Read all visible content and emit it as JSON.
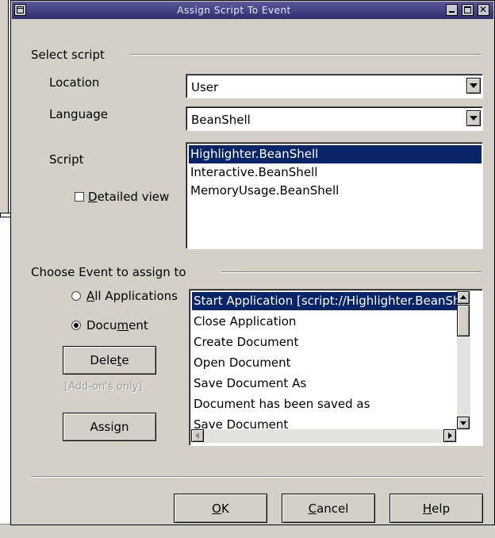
{
  "window": {
    "title": "Assign Script To Event"
  },
  "select_script": {
    "section_label": "Select script",
    "location_label": "Location",
    "location_value": "User",
    "language_label": "Language",
    "language_value": "BeanShell",
    "script_label": "Script",
    "detailed_view_label": "Detailed view",
    "scripts": [
      "Highlighter.BeanShell",
      "Interactive.BeanShell",
      "MemoryUsage.BeanShell"
    ],
    "selected_script_index": 0
  },
  "choose_event": {
    "section_label": "Choose Event to assign to",
    "all_applications_label": "All Applications",
    "document_label": "Document",
    "selected_scope": "Document",
    "delete_label": "Delete",
    "addon_note": "[Add-on's only]",
    "assign_label": "Assign",
    "events": [
      "Start Application  [script://Highlighter.BeanShell",
      "Close Application",
      "Create Document",
      "Open Document",
      "Save Document As",
      "Document has been saved as",
      "Save Document"
    ],
    "selected_event_index": 0
  },
  "footer": {
    "ok_label": "OK",
    "cancel_label": "Cancel",
    "help_label": "Help"
  }
}
